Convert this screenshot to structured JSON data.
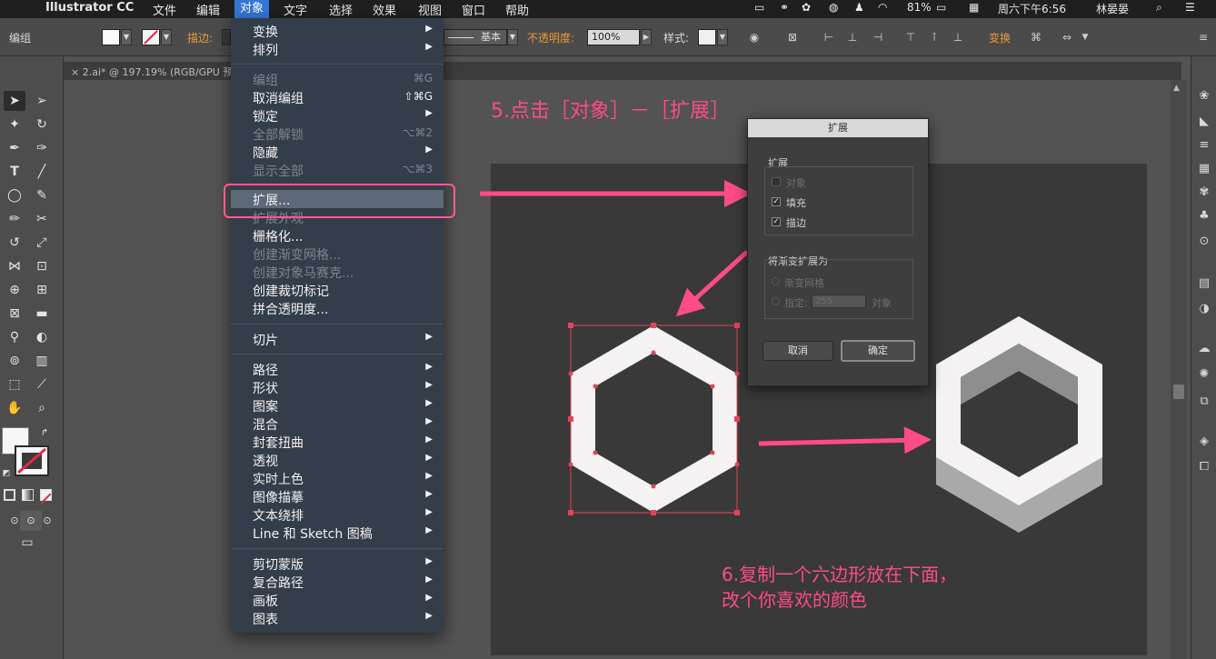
{
  "menubar": {
    "app_name": "Illustrator CC",
    "items": [
      "文件",
      "编辑",
      "对象",
      "文字",
      "选择",
      "效果",
      "视图",
      "窗口",
      "帮助"
    ],
    "active_item": "对象",
    "battery": "81%",
    "clock": "周六下午6:56",
    "user": "林晏晏"
  },
  "control_bar": {
    "selection_label": "编组",
    "stroke_label": "描边:",
    "stroke_profile": "基本",
    "opacity_label": "不透明度:",
    "opacity_value": "100%",
    "style_label": "样式:",
    "transform_label": "变换"
  },
  "document_tab": {
    "title": "2.ai* @ 197.19% (RGB/GPU 预"
  },
  "object_menu": {
    "items": [
      {
        "label": "变换",
        "submenu": true
      },
      {
        "label": "排列",
        "submenu": true
      },
      {
        "label": "编组",
        "shortcut": "⌘G",
        "disabled": true
      },
      {
        "label": "取消编组",
        "shortcut": "⇧⌘G"
      },
      {
        "label": "锁定",
        "submenu": true
      },
      {
        "label": "全部解锁",
        "shortcut": "⌥⌘2",
        "disabled": true
      },
      {
        "label": "隐藏",
        "submenu": true
      },
      {
        "label": "显示全部",
        "shortcut": "⌥⌘3",
        "disabled": true
      },
      {
        "label": "扩展...",
        "highlighted": true
      },
      {
        "label": "扩展外观",
        "disabled": true
      },
      {
        "label": "栅格化..."
      },
      {
        "label": "创建渐变网格...",
        "disabled": true
      },
      {
        "label": "创建对象马赛克...",
        "disabled": true
      },
      {
        "label": "创建裁切标记"
      },
      {
        "label": "拼合透明度..."
      },
      {
        "label": "切片",
        "submenu": true
      },
      {
        "label": "路径",
        "submenu": true
      },
      {
        "label": "形状",
        "submenu": true
      },
      {
        "label": "图案",
        "submenu": true
      },
      {
        "label": "混合",
        "submenu": true
      },
      {
        "label": "封套扭曲",
        "submenu": true
      },
      {
        "label": "透视",
        "submenu": true
      },
      {
        "label": "实时上色",
        "submenu": true
      },
      {
        "label": "图像描摹",
        "submenu": true
      },
      {
        "label": "文本绕排",
        "submenu": true
      },
      {
        "label": "Line 和 Sketch 图稿",
        "submenu": true
      },
      {
        "label": "剪切蒙版",
        "submenu": true
      },
      {
        "label": "复合路径",
        "submenu": true
      },
      {
        "label": "画板",
        "submenu": true
      },
      {
        "label": "图表",
        "submenu": true
      }
    ],
    "submenu_glyph": "▶"
  },
  "expand_dialog": {
    "title": "扩展",
    "group1_label": "扩展",
    "opt_object": "对象",
    "opt_fill": "填充",
    "opt_stroke": "描边",
    "fill_checked": true,
    "stroke_checked": true,
    "group2_label": "将渐变扩展为",
    "opt_gradient_mesh": "渐变网格",
    "opt_specify": "指定:",
    "specify_value": "255",
    "opt_objects_unit": "对象",
    "cancel_label": "取消",
    "ok_label": "确定"
  },
  "annotations": {
    "step5": "5.点击［对象］－［扩展］",
    "step6_line1": "6.复制一个六边形放在下面，",
    "step6_line2": "改个你喜欢的颜色"
  },
  "colors": {
    "accent_pink": "#ff4b87",
    "menu_bg": "#343d4a",
    "artboard": "#393939",
    "hexagon_fill": "#f4f2f2",
    "hexagon_shadow": "#a9a9a9",
    "selection_red": "#e0455a"
  }
}
